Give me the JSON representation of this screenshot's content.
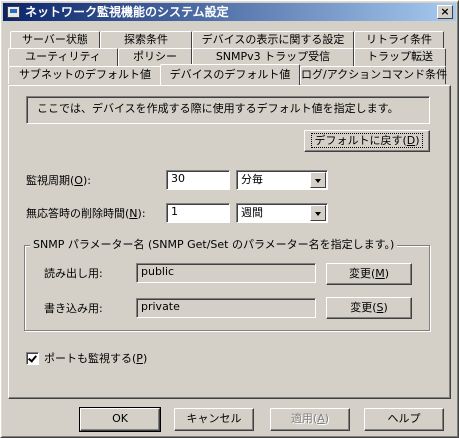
{
  "window": {
    "title": "ネットワーク監視機能のシステム設定",
    "close_label": "×"
  },
  "tabs": {
    "row1": [
      "サーバー状態",
      "探索条件",
      "デバイスの表示に関する設定",
      "リトライ条件"
    ],
    "row2": [
      "ユーティリティ",
      "ポリシー",
      "SNMPv3 トラップ受信",
      "トラップ転送"
    ],
    "row3": [
      "サブネットのデフォルト値",
      "デバイスのデフォルト値",
      "ログ/アクションコマンド条件"
    ],
    "active": "デバイスのデフォルト値"
  },
  "panel": {
    "info_text": "ここでは、デバイスを作成する際に使用するデフォルト値を指定します。",
    "reset_button": {
      "text": "デフォルトに戻す(",
      "key": "D",
      "suffix": ")"
    },
    "interval": {
      "label": "監視周期(",
      "key": "O",
      "suffix": "):",
      "value": "30",
      "unit": "分毎"
    },
    "delete_time": {
      "label": "無応答時の削除時間(",
      "key": "N",
      "suffix": "):",
      "value": "1",
      "unit": "週間"
    },
    "snmp_group": {
      "legend": "SNMP パラメーター名 (SNMP Get/Set のパラメーター名を指定します。)",
      "read": {
        "label": "読み出し用:",
        "value": "public",
        "button": {
          "text": "変更(",
          "key": "M",
          "suffix": ")"
        }
      },
      "write": {
        "label": "書き込み用:",
        "value": "private",
        "button": {
          "text": "変更(",
          "key": "S",
          "suffix": ")"
        }
      }
    },
    "port_monitor": {
      "checked": true,
      "label": "ポートも監視する(",
      "key": "P",
      "suffix": ")"
    }
  },
  "footer": {
    "ok": "OK",
    "cancel": "キャンセル",
    "apply": {
      "text": "適用(",
      "key": "A",
      "suffix": ")"
    },
    "help": "ヘルプ"
  }
}
